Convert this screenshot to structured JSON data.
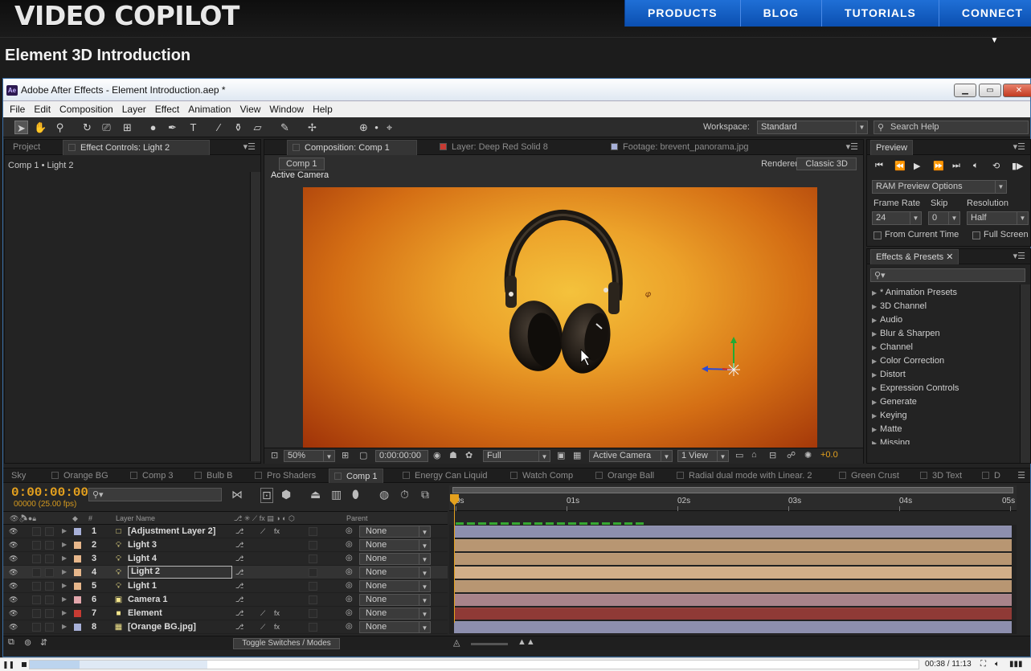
{
  "site": {
    "logo": "VIDEO COPILOT",
    "nav": [
      "PRODUCTS",
      "BLOG",
      "TUTORIALS",
      "CONNECT"
    ],
    "page_title": "Element 3D Introduction"
  },
  "app": {
    "title": "Adobe After Effects - Element Introduction.aep *",
    "logo_text": "Ae",
    "menu": [
      "File",
      "Edit",
      "Composition",
      "Layer",
      "Effect",
      "Animation",
      "View",
      "Window",
      "Help"
    ],
    "workspace_label": "Workspace:",
    "workspace_value": "Standard",
    "search_help_placeholder": "Search Help"
  },
  "left_panel": {
    "tabs": [
      "Project",
      "Effect Controls: Light 2"
    ],
    "breadcrumb": "Comp 1 • Light 2"
  },
  "viewer": {
    "tabs": [
      "Composition: Comp 1",
      "Layer: Deep Red Solid 8",
      "Footage: brevent_panorama.jpg"
    ],
    "comp_button": "Comp 1",
    "renderer_label": "Renderer:",
    "renderer_value": "Classic 3D",
    "overlay_label": "Active Camera",
    "zoom": "50%",
    "timecode": "0:00:00:00",
    "resolution": "Full",
    "view": "Active Camera",
    "views": "1 View",
    "exposure": "+0.0"
  },
  "preview": {
    "tab": "Preview",
    "ram_options": "RAM Preview Options",
    "frame_rate_label": "Frame Rate",
    "skip_label": "Skip",
    "resolution_label": "Resolution",
    "frame_rate": "24",
    "skip": "0",
    "resolution": "Half",
    "from_current_time": "From Current Time",
    "full_screen": "Full Screen"
  },
  "effects_presets": {
    "tab": "Effects & Presets",
    "items": [
      "* Animation Presets",
      "3D Channel",
      "Audio",
      "Blur & Sharpen",
      "Channel",
      "Color Correction",
      "Distort",
      "Expression Controls",
      "Generate",
      "Keying",
      "Matte",
      "Missing"
    ]
  },
  "timeline": {
    "tabs": [
      "Sky",
      "Orange BG",
      "Comp 3",
      "Bulb B",
      "Pro Shaders",
      "Comp 1",
      "Energy Can Liquid",
      "Watch Comp",
      "Orange Ball",
      "Radial dual mode with Linear. 2",
      "Green Crust",
      "3D Text",
      "D"
    ],
    "active_tab": "Comp 1",
    "timecode": "0:00:00:00",
    "fps": "00000 (25.00 fps)",
    "header": {
      "num": "#",
      "name": "Layer Name",
      "parent": "Parent"
    },
    "ruler": [
      "0s",
      "01s",
      "02s",
      "03s",
      "04s",
      "05s"
    ],
    "toggle_label": "Toggle Switches / Modes",
    "layers": [
      {
        "num": "1",
        "name": "[Adjustment Layer 2]",
        "parent": "None",
        "label_color": "#a7b0d8",
        "bar_color": "#8d8fae",
        "type": "adjustment",
        "fx": true
      },
      {
        "num": "2",
        "name": "Light 3",
        "parent": "None",
        "label_color": "#e7b78b",
        "bar_color": "#b89672",
        "type": "light",
        "fx": false
      },
      {
        "num": "3",
        "name": "Light 4",
        "parent": "None",
        "label_color": "#e7b78b",
        "bar_color": "#b89672",
        "type": "light",
        "fx": false
      },
      {
        "num": "4",
        "name": "Light 2",
        "parent": "None",
        "label_color": "#e7b78b",
        "bar_color": "#d2ae88",
        "type": "light",
        "fx": false,
        "selected": true
      },
      {
        "num": "5",
        "name": "Light 1",
        "parent": "None",
        "label_color": "#e7b78b",
        "bar_color": "#b89672",
        "type": "light",
        "fx": false
      },
      {
        "num": "6",
        "name": "Camera 1",
        "parent": "None",
        "label_color": "#e3a7ac",
        "bar_color": "#a8838a",
        "type": "camera",
        "fx": false
      },
      {
        "num": "7",
        "name": "Element",
        "parent": "None",
        "label_color": "#c73b33",
        "bar_color": "#8f3a36",
        "type": "solid",
        "fx": true
      },
      {
        "num": "8",
        "name": "[Orange BG.jpg]",
        "parent": "None",
        "label_color": "#a7b0d8",
        "bar_color": "#8d8fae",
        "type": "footage",
        "fx": true
      }
    ]
  },
  "player": {
    "time": "00:38 / 11:13",
    "played_fraction": 0.056,
    "buffered_fraction": 0.2
  }
}
